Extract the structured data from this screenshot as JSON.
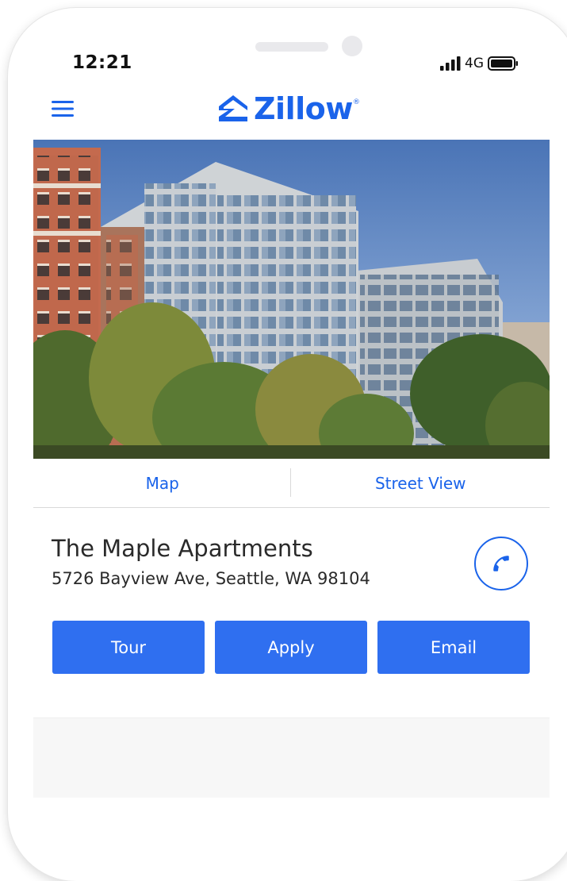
{
  "status_bar": {
    "time": "12:21",
    "network": "4G",
    "icons": [
      "signal-bars-icon",
      "battery-icon"
    ]
  },
  "header": {
    "menu_icon": "hamburger-menu-icon",
    "logo_text": "Zillow",
    "logo_registered": "®",
    "logo_icon": "zillow-house-icon"
  },
  "photo": {
    "subject": "apartment-building-photo"
  },
  "view_tabs": [
    {
      "label": "Map"
    },
    {
      "label": "Street View"
    }
  ],
  "listing": {
    "name": "The Maple Apartments",
    "address": "5726 Bayview Ave, Seattle, WA 98104",
    "call_icon": "phone-icon"
  },
  "actions": {
    "tour_label": "Tour",
    "apply_label": "Apply",
    "email_label": "Email"
  },
  "colors": {
    "brand_blue": "#1a63ea",
    "button_blue": "#2f6ff0",
    "text_dark": "#2a2a2a"
  }
}
